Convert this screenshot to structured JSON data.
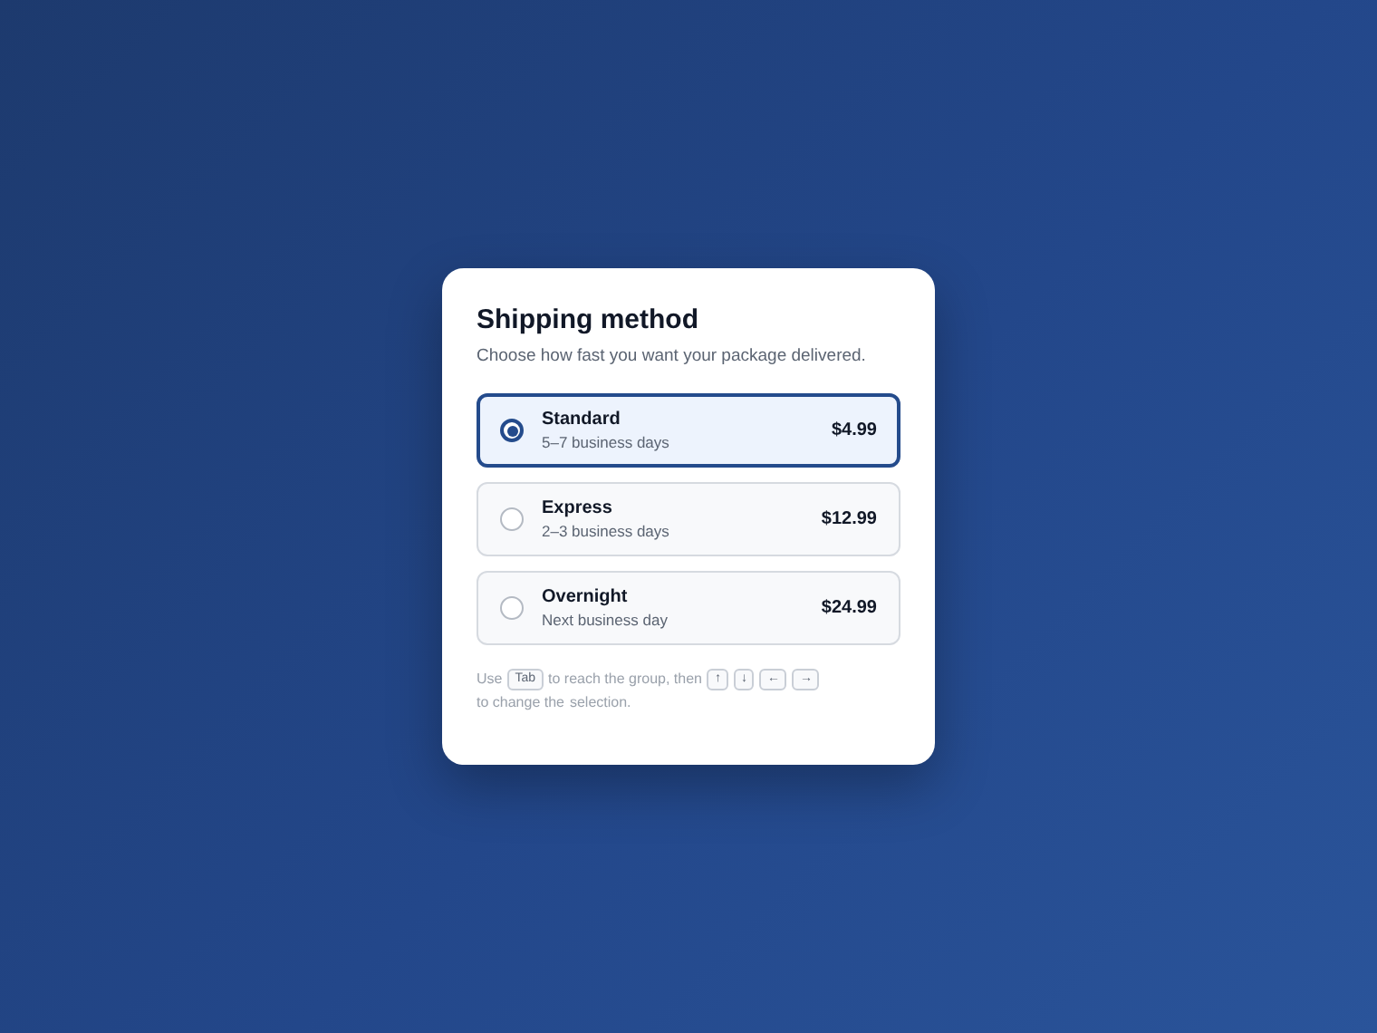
{
  "card": {
    "title": "Shipping method",
    "subtitle": "Choose how fast you want your package delivered."
  },
  "options": [
    {
      "name": "Standard",
      "detail": "5–7 business days",
      "price": "$4.99",
      "selected": true
    },
    {
      "name": "Express",
      "detail": "2–3 business days",
      "price": "$12.99",
      "selected": false
    },
    {
      "name": "Overnight",
      "detail": "Next business day",
      "price": "$24.99",
      "selected": false
    }
  ],
  "hint": [
    {
      "kind": "text",
      "text": "Use"
    },
    {
      "kind": "key",
      "text": "Tab"
    },
    {
      "kind": "text",
      "text": "to reach the group, then"
    },
    {
      "kind": "key",
      "text": "↑"
    },
    {
      "kind": "key",
      "text": "↓"
    },
    {
      "kind": "key",
      "text": "←"
    },
    {
      "kind": "key",
      "text": "→"
    },
    {
      "kind": "text",
      "text": "to change the"
    },
    {
      "kind": "text",
      "text": "selection."
    }
  ]
}
